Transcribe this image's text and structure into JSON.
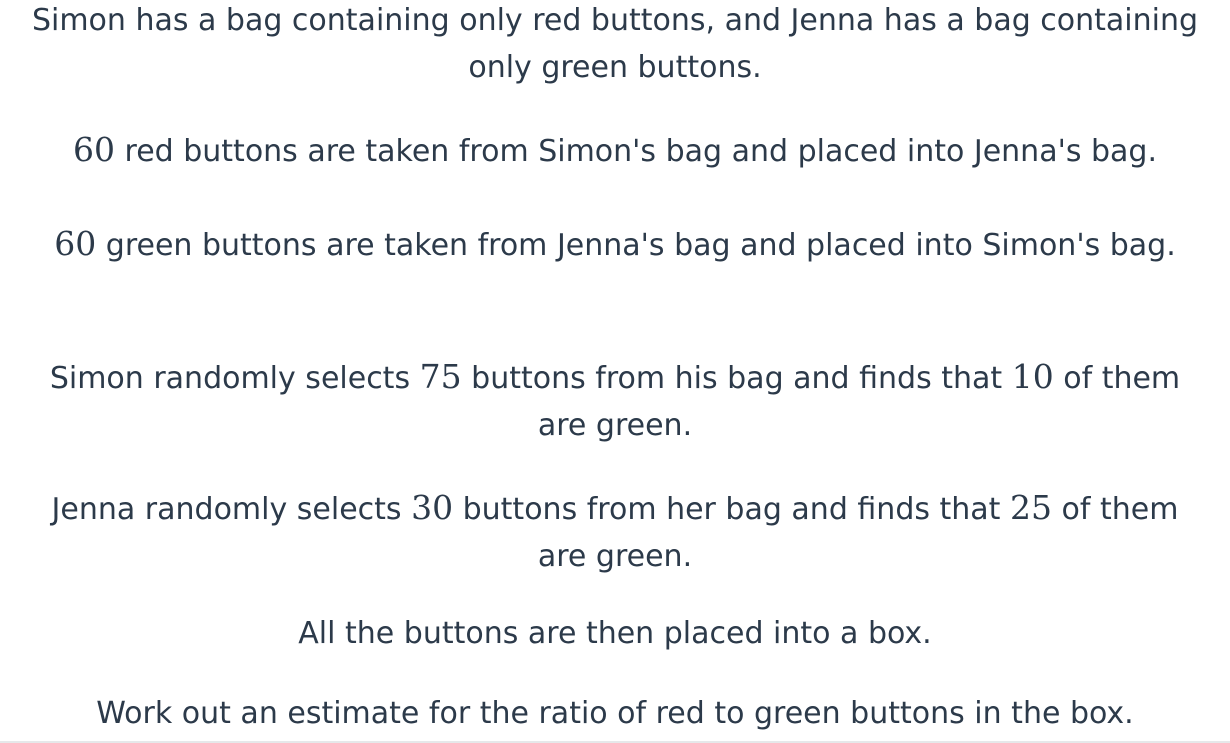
{
  "question": {
    "intro": "Simon has a bag containing only red buttons, and Jenna has a bag containing only green buttons.",
    "move_red": {
      "number": "60",
      "text": " red buttons are taken from Simon's bag and placed into Jenna's bag."
    },
    "move_green": {
      "number": "60",
      "text": " green buttons are taken from Jenna's bag and placed into Simon's bag."
    },
    "simon_sample": {
      "text_a": "Simon randomly selects ",
      "selected": "75",
      "text_b": " buttons from his bag and finds that ",
      "green": "10",
      "text_c": " of them are green."
    },
    "jenna_sample": {
      "text_a": "Jenna randomly selects ",
      "selected": "30",
      "text_b": " buttons from her bag and finds that ",
      "green": "25",
      "text_c": " of them are green."
    },
    "combine": "All the buttons are then placed into a box.",
    "task": "Work out an estimate for the ratio of red to green buttons in the box."
  }
}
